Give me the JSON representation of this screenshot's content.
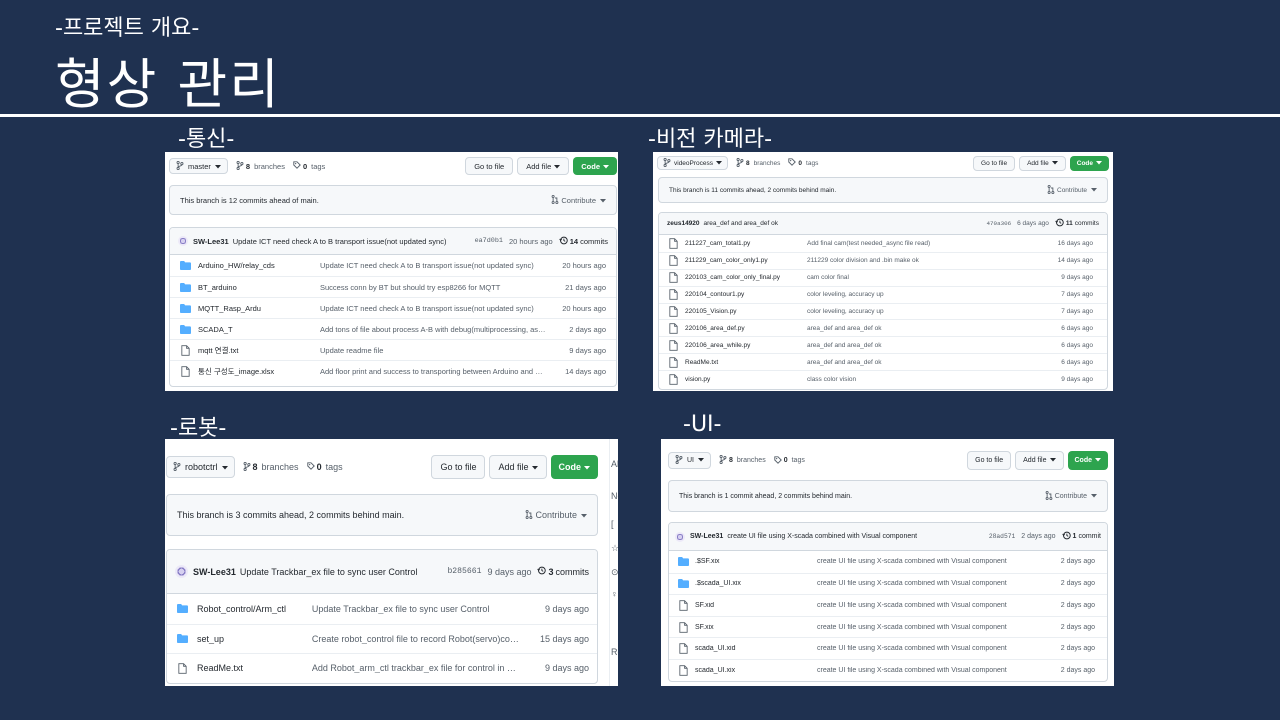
{
  "slide": {
    "subtitle": "-프로젝트 개요-",
    "title": "형상 관리"
  },
  "colors": {
    "background": "#1f3150",
    "code_button": "#2da44e",
    "folder": "#54aeff"
  },
  "panels": [
    {
      "caption": "-통신-",
      "branch": "master",
      "branches_count": "8",
      "branches_label": "branches",
      "tags_count": "0",
      "tags_label": "tags",
      "goto_label": "Go to file",
      "add_label": "Add file",
      "code_label": "Code",
      "ahead_text": "This branch is 12 commits ahead of main.",
      "contribute_label": "Contribute",
      "commit": {
        "author": "SW-Lee31",
        "message": "Update ICT need check A to B transport issue(not updated sync)",
        "hash": "ea7d0b1",
        "time": "20 hours ago",
        "count": "14",
        "count_label": "commits"
      },
      "files": [
        {
          "type": "folder",
          "name": "Arduino_HW/relay_cds",
          "message": "Update ICT need check A to B transport issue(not updated sync)",
          "age": "20 hours ago"
        },
        {
          "type": "folder",
          "name": "BT_arduino",
          "message": "Success conn by BT but should try esp8266 for MQTT",
          "age": "21 days ago"
        },
        {
          "type": "folder",
          "name": "MQTT_Rasp_Ardu",
          "message": "Update ICT need check A to B transport issue(not updated sync)",
          "age": "20 hours ago"
        },
        {
          "type": "folder",
          "name": "SCADA_T",
          "message": "Add tons of file about process A-B with debug(multiprocessing, asynci...",
          "age": "2 days ago"
        },
        {
          "type": "file",
          "name": "mqtt 연결.txt",
          "message": "Update readme file",
          "age": "9 days ago"
        },
        {
          "type": "file",
          "name": "통신 구성도_image.xlsx",
          "message": "Add floor print and success to transporting between Arduino and Raspb...",
          "age": "14 days ago"
        }
      ]
    },
    {
      "caption": "-비전 카메라-",
      "branch": "videoProcess",
      "branches_count": "8",
      "branches_label": "branches",
      "tags_count": "0",
      "tags_label": "tags",
      "goto_label": "Go to file",
      "add_label": "Add file",
      "code_label": "Code",
      "ahead_text": "This branch is 11 commits ahead, 2 commits behind main.",
      "contribute_label": "Contribute",
      "commit": {
        "author": "zeus14920",
        "message": "area_def and area_def ok",
        "hash": "470a306",
        "time": "6 days ago",
        "count": "11",
        "count_label": "commits"
      },
      "files": [
        {
          "type": "file",
          "name": "211227_cam_total1.py",
          "message": "Add final cam(test needed_async file read)",
          "age": "16 days ago"
        },
        {
          "type": "file",
          "name": "211229_cam_color_only1.py",
          "message": "211229 color division and .bin make ok",
          "age": "14 days ago"
        },
        {
          "type": "file",
          "name": "220103_cam_color_only_final.py",
          "message": "cam color final",
          "age": "9 days ago"
        },
        {
          "type": "file",
          "name": "220104_contour1.py",
          "message": "color leveling, accuracy up",
          "age": "7 days ago"
        },
        {
          "type": "file",
          "name": "220105_Vision.py",
          "message": "color leveling, accuracy up",
          "age": "7 days ago"
        },
        {
          "type": "file",
          "name": "220106_area_def.py",
          "message": "area_def and area_def ok",
          "age": "6 days ago"
        },
        {
          "type": "file",
          "name": "220106_area_while.py",
          "message": "area_def and area_def ok",
          "age": "6 days ago"
        },
        {
          "type": "file",
          "name": "ReadMe.txt",
          "message": "area_def and area_def ok",
          "age": "6 days ago"
        },
        {
          "type": "file",
          "name": "vision.py",
          "message": "class color vision",
          "age": "9 days ago"
        }
      ]
    },
    {
      "caption": "-로봇-",
      "branch": "robotctrl",
      "branches_count": "8",
      "branches_label": "branches",
      "tags_count": "0",
      "tags_label": "tags",
      "goto_label": "Go to file",
      "add_label": "Add file",
      "code_label": "Code",
      "ahead_text": "This branch is 3 commits ahead, 2 commits behind main.",
      "contribute_label": "Contribute",
      "commit": {
        "author": "SW-Lee31",
        "message": "Update Trackbar_ex file to sync user Control",
        "hash": "b285661",
        "time": "9 days ago",
        "count": "3",
        "count_label": "commits"
      },
      "files": [
        {
          "type": "folder",
          "name": "Robot_control/Arm_ctl",
          "message": "Update Trackbar_ex file to sync user Control",
          "age": "9 days ago"
        },
        {
          "type": "folder",
          "name": "set_up",
          "message": "Create robot_control file to record Robot(servo)control with using i2...",
          "age": "15 days ago"
        },
        {
          "type": "file",
          "name": "ReadMe.txt",
          "message": "Add Robot_arm_ctl trackbar_ex file for control in GUI(reading servo v...",
          "age": "9 days ago"
        }
      ],
      "side_fragments": [
        "Al",
        "No",
        "[",
        "☆",
        "⊙",
        "♀",
        "Re"
      ]
    },
    {
      "caption": "-UI-",
      "branch": "UI",
      "branches_count": "8",
      "branches_label": "branches",
      "tags_count": "0",
      "tags_label": "tags",
      "goto_label": "Go to file",
      "add_label": "Add file",
      "code_label": "Code",
      "ahead_text": "This branch is 1 commit ahead, 2 commits behind main.",
      "contribute_label": "Contribute",
      "commit": {
        "author": "SW-Lee31",
        "message": "create UI file using X-scada combined with Visual component",
        "hash": "28ad571",
        "time": "2 days ago",
        "count": "1",
        "count_label": "commit"
      },
      "files": [
        {
          "type": "folder",
          "name": ".$SF.xix",
          "message": "create UI file using X-scada combined with Visual component",
          "age": "2 days ago"
        },
        {
          "type": "folder",
          "name": ".$scada_UI.xix",
          "message": "create UI file using X-scada combined with Visual component",
          "age": "2 days ago"
        },
        {
          "type": "file",
          "name": "SF.xid",
          "message": "create UI file using X-scada combined with Visual component",
          "age": "2 days ago"
        },
        {
          "type": "file",
          "name": "SF.xix",
          "message": "create UI file using X-scada combined with Visual component",
          "age": "2 days ago"
        },
        {
          "type": "file",
          "name": "scada_UI.xid",
          "message": "create UI file using X-scada combined with Visual component",
          "age": "2 days ago"
        },
        {
          "type": "file",
          "name": "scada_UI.xix",
          "message": "create UI file using X-scada combined with Visual component",
          "age": "2 days ago"
        }
      ]
    }
  ]
}
